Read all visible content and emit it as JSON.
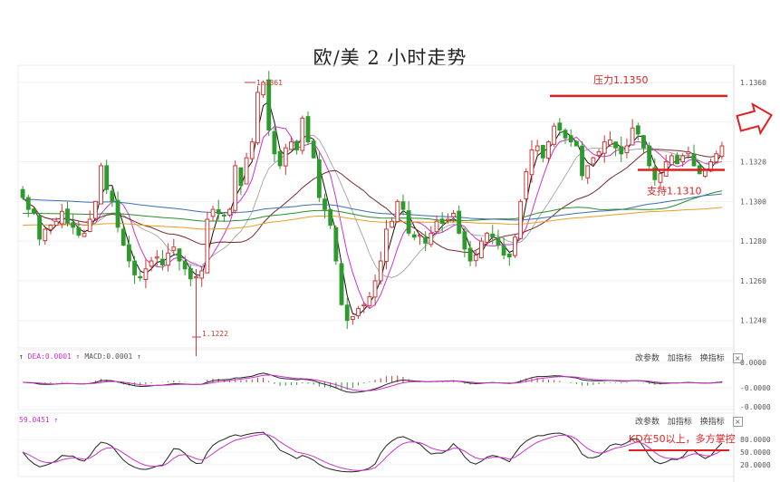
{
  "title": "欧/美 2 小时走势",
  "colors": {
    "up": "#c83a3a",
    "down": "#2e9a2e",
    "annotation": "#e02020",
    "ma_black": "#111111",
    "ma_magenta": "#cc33cc",
    "ma_gray": "#999999",
    "ma_maroon": "#7a2a2a",
    "ma_green": "#2e8b2e",
    "ma_blue": "#3a6fb0",
    "ma_orange": "#e6a020"
  },
  "main": {
    "ticks": [
      "1.1360",
      "1.1340",
      "1.1320",
      "1.1300",
      "1.1280",
      "1.1260",
      "1.1240"
    ],
    "high_label": "1.1361",
    "low_label": "1.1222",
    "resistance_label": "压力1.1350",
    "support_label": "支持1.1310",
    "resistance_value": 1.135,
    "support_value": 1.131
  },
  "macd": {
    "legend_dea": "DEA:0.0001",
    "legend_macd": "MACD:0.0001",
    "ticks": [
      "0.0000",
      "-0.0000",
      "-0.0000"
    ],
    "buttons": [
      "改参数",
      "加指标",
      "换指标"
    ]
  },
  "kd": {
    "legend": "59.0451",
    "ticks": [
      "80.0000",
      "50.0000",
      "20.0000"
    ],
    "buttons": [
      "改参数",
      "加指标",
      "换指标"
    ],
    "annotation": "KD在50以上，多方掌控",
    "annotation_value": 50
  },
  "chart_data": {
    "type": "candlestick",
    "title": "欧/美 2 小时走势",
    "ylim": [
      1.1222,
      1.1365
    ],
    "high": 1.1361,
    "low": 1.1222,
    "close": [
      1.1302,
      1.1296,
      1.1294,
      1.1281,
      1.1286,
      1.1288,
      1.129,
      1.1295,
      1.1289,
      1.1287,
      1.1283,
      1.1284,
      1.1291,
      1.13,
      1.1318,
      1.1306,
      1.13,
      1.1287,
      1.1278,
      1.127,
      1.1263,
      1.1262,
      1.1266,
      1.127,
      1.1272,
      1.1268,
      1.1274,
      1.1277,
      1.127,
      1.1266,
      1.1261,
      1.1262,
      1.1265,
      1.1291,
      1.1296,
      1.1294,
      1.1293,
      1.1296,
      1.1318,
      1.1308,
      1.1322,
      1.133,
      1.1355,
      1.136,
      1.1336,
      1.1324,
      1.1318,
      1.1327,
      1.133,
      1.1326,
      1.1342,
      1.133,
      1.1322,
      1.1302,
      1.1296,
      1.1288,
      1.127,
      1.1248,
      1.124,
      1.1242,
      1.1246,
      1.1248,
      1.1252,
      1.126,
      1.127,
      1.1286,
      1.129,
      1.13,
      1.1296,
      1.1284,
      1.1282,
      1.1283,
      1.1279,
      1.1284,
      1.129,
      1.1289,
      1.1291,
      1.1294,
      1.1284,
      1.1276,
      1.127,
      1.1273,
      1.128,
      1.1284,
      1.1282,
      1.1278,
      1.1273,
      1.1272,
      1.1282,
      1.13,
      1.1315,
      1.1326,
      1.1328,
      1.1322,
      1.133,
      1.1338,
      1.1336,
      1.1332,
      1.133,
      1.1328,
      1.1313,
      1.1318,
      1.1322,
      1.1325,
      1.133,
      1.1331,
      1.1327,
      1.1324,
      1.1328,
      1.1337,
      1.1334,
      1.1327,
      1.1318,
      1.1311,
      1.1314,
      1.132,
      1.1323,
      1.1319,
      1.1323,
      1.1325,
      1.1318,
      1.1314,
      1.1316,
      1.132,
      1.1324,
      1.1328
    ],
    "series": [
      {
        "type": "macd"
      },
      {
        "type": "kd"
      }
    ]
  }
}
